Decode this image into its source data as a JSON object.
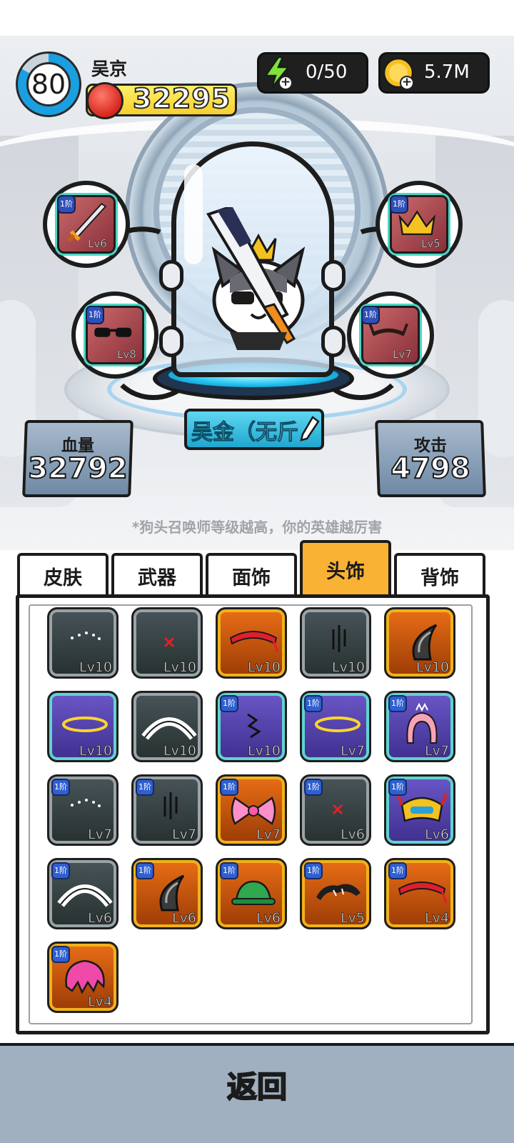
{
  "player": {
    "level": "80",
    "name": "吴京",
    "power": "32295"
  },
  "resources": {
    "energy": "0/50",
    "gold": "5.7M"
  },
  "equipment": {
    "weapon": {
      "rank": "1阶",
      "level": "Lv6",
      "icon": "sword-icon"
    },
    "head": {
      "rank": "1阶",
      "level": "Lv5",
      "icon": "crown-icon"
    },
    "face": {
      "rank": "1阶",
      "level": "Lv8",
      "icon": "sunglasses-icon"
    },
    "back": {
      "rank": "1阶",
      "level": "Lv7",
      "icon": "horns-icon"
    }
  },
  "hero": {
    "name": "吴金（无斤"
  },
  "stats": {
    "hp_label": "血量",
    "hp_value": "32792",
    "atk_label": "攻击",
    "atk_value": "4798"
  },
  "hint": "*狗头召唤师等级越高，你的英雄越厉害",
  "tabs": [
    {
      "label": "皮肤",
      "active": false
    },
    {
      "label": "武器",
      "active": false
    },
    {
      "label": "面饰",
      "active": false
    },
    {
      "label": "头饰",
      "active": true
    },
    {
      "label": "背饰",
      "active": false
    }
  ],
  "items": [
    {
      "level": "Lv10",
      "rarity": "gray",
      "rank": "",
      "icon": "sparkle-dots-icon"
    },
    {
      "level": "Lv10",
      "rarity": "gray",
      "rank": "",
      "icon": "anger-mark-icon"
    },
    {
      "level": "Lv10",
      "rarity": "orange",
      "rank": "",
      "icon": "red-headband-icon"
    },
    {
      "level": "Lv10",
      "rarity": "gray",
      "rank": "",
      "icon": "gloom-lines-icon"
    },
    {
      "level": "Lv10",
      "rarity": "orange",
      "rank": "",
      "icon": "black-horn-icon"
    },
    {
      "level": "Lv10",
      "rarity": "purple",
      "rank": "",
      "icon": "halo-icon"
    },
    {
      "level": "Lv10",
      "rarity": "gray",
      "rank": "",
      "icon": "maid-headband-icon"
    },
    {
      "level": "Lv10",
      "rarity": "purple",
      "rank": "1阶",
      "icon": "crack-icon"
    },
    {
      "level": "Lv7",
      "rarity": "purple",
      "rank": "1阶",
      "icon": "halo-icon"
    },
    {
      "level": "Lv7",
      "rarity": "purple",
      "rank": "1阶",
      "icon": "pink-hair-tiara-icon"
    },
    {
      "level": "Lv7",
      "rarity": "gray",
      "rank": "1阶",
      "icon": "sparkle-dots-icon"
    },
    {
      "level": "Lv7",
      "rarity": "gray",
      "rank": "1阶",
      "icon": "gloom-lines-icon"
    },
    {
      "level": "Lv7",
      "rarity": "orange",
      "rank": "1阶",
      "icon": "pink-bow-icon"
    },
    {
      "level": "Lv6",
      "rarity": "gray",
      "rank": "1阶",
      "icon": "anger-mark-icon"
    },
    {
      "level": "Lv6",
      "rarity": "purple",
      "rank": "1阶",
      "icon": "jester-mask-icon"
    },
    {
      "level": "Lv6",
      "rarity": "gray",
      "rank": "1阶",
      "icon": "maid-headband-icon"
    },
    {
      "level": "Lv6",
      "rarity": "orange",
      "rank": "1阶",
      "icon": "black-horn-icon"
    },
    {
      "level": "Lv6",
      "rarity": "orange",
      "rank": "1阶",
      "icon": "green-hat-icon"
    },
    {
      "level": "Lv5",
      "rarity": "orange",
      "rank": "1阶",
      "icon": "messy-hair-icon"
    },
    {
      "level": "Lv4",
      "rarity": "orange",
      "rank": "1阶",
      "icon": "red-headband-icon"
    },
    {
      "level": "Lv4",
      "rarity": "orange",
      "rank": "1阶",
      "icon": "pink-hair-icon"
    }
  ],
  "back_label": "返回"
}
